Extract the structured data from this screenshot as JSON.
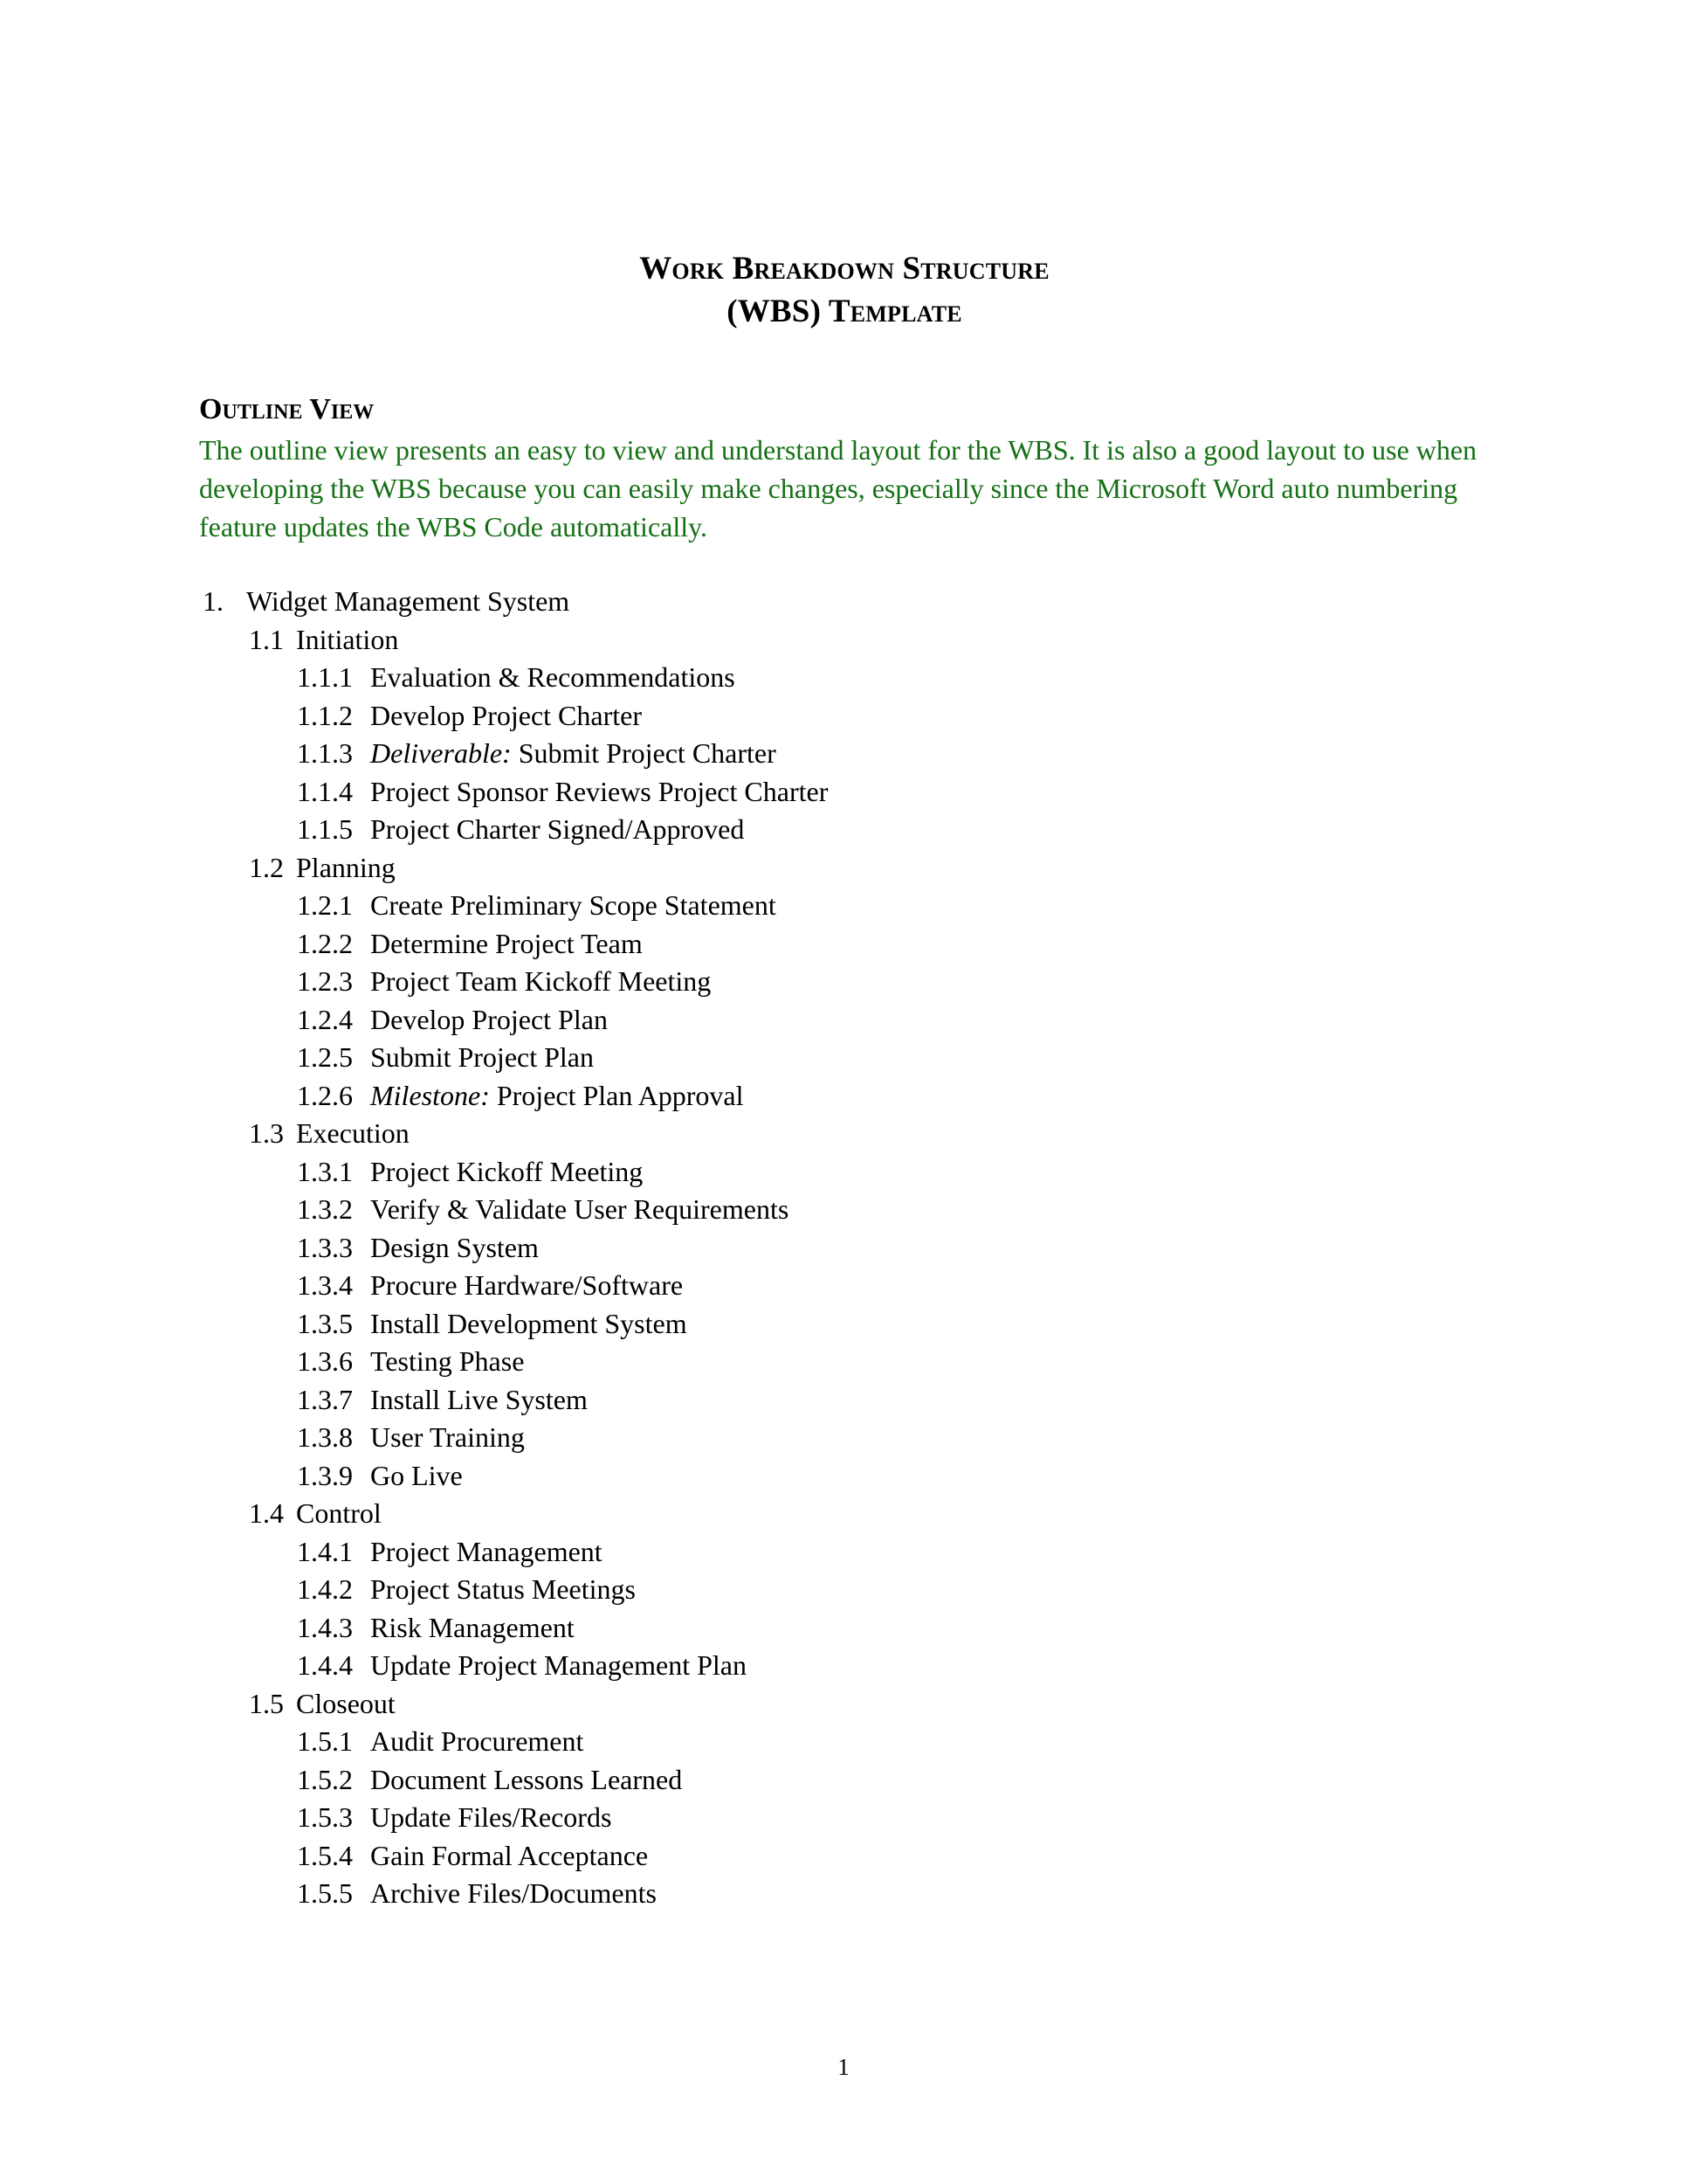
{
  "document": {
    "title_lines": [
      "Work Breakdown Structure",
      "(WBS) Template"
    ],
    "section_heading": "Outline View",
    "intro_paragraph": "The outline view presents an easy to view and understand layout for the WBS.  It is also a good layout to use when developing the WBS because you can easily make changes, especially since the Microsoft Word auto numbering feature updates the WBS Code automatically.",
    "intro_color": "#157015",
    "page_number": "1"
  },
  "outline": {
    "items": [
      {
        "level": 1,
        "code": "1.",
        "text": "Widget Management System"
      },
      {
        "level": 2,
        "code": "1.1",
        "text": "Initiation"
      },
      {
        "level": 3,
        "code": "1.1.1",
        "text": "Evaluation & Recommendations"
      },
      {
        "level": 3,
        "code": "1.1.2",
        "text": "Develop Project Charter"
      },
      {
        "level": 3,
        "code": "1.1.3",
        "emphasis": "Deliverable:",
        "text": " Submit Project Charter"
      },
      {
        "level": 3,
        "code": "1.1.4",
        "text": "Project Sponsor Reviews Project Charter"
      },
      {
        "level": 3,
        "code": "1.1.5",
        "text": "Project Charter Signed/Approved"
      },
      {
        "level": 2,
        "code": "1.2",
        "text": "Planning"
      },
      {
        "level": 3,
        "code": "1.2.1",
        "text": "Create Preliminary Scope Statement"
      },
      {
        "level": 3,
        "code": "1.2.2",
        "text": "Determine Project Team"
      },
      {
        "level": 3,
        "code": "1.2.3",
        "text": "Project Team Kickoff Meeting"
      },
      {
        "level": 3,
        "code": "1.2.4",
        "text": "Develop Project Plan"
      },
      {
        "level": 3,
        "code": "1.2.5",
        "text": "Submit Project Plan"
      },
      {
        "level": 3,
        "code": "1.2.6",
        "emphasis": "Milestone:",
        "text": " Project Plan Approval"
      },
      {
        "level": 2,
        "code": "1.3",
        "text": "Execution"
      },
      {
        "level": 3,
        "code": "1.3.1",
        "text": "Project Kickoff Meeting"
      },
      {
        "level": 3,
        "code": "1.3.2",
        "text": "Verify & Validate User Requirements"
      },
      {
        "level": 3,
        "code": "1.3.3",
        "text": "Design System"
      },
      {
        "level": 3,
        "code": "1.3.4",
        "text": "Procure Hardware/Software"
      },
      {
        "level": 3,
        "code": "1.3.5",
        "text": "Install Development System"
      },
      {
        "level": 3,
        "code": "1.3.6",
        "text": "Testing Phase"
      },
      {
        "level": 3,
        "code": "1.3.7",
        "text": "Install Live System"
      },
      {
        "level": 3,
        "code": "1.3.8",
        "text": "User Training"
      },
      {
        "level": 3,
        "code": "1.3.9",
        "text": "Go Live"
      },
      {
        "level": 2,
        "code": "1.4",
        "text": "Control"
      },
      {
        "level": 3,
        "code": "1.4.1",
        "text": "Project Management"
      },
      {
        "level": 3,
        "code": "1.4.2",
        "text": "Project Status Meetings"
      },
      {
        "level": 3,
        "code": "1.4.3",
        "text": "Risk Management"
      },
      {
        "level": 3,
        "code": "1.4.4",
        "text": "Update Project Management Plan"
      },
      {
        "level": 2,
        "code": "1.5",
        "text": "Closeout"
      },
      {
        "level": 3,
        "code": "1.5.1",
        "text": "Audit Procurement"
      },
      {
        "level": 3,
        "code": "1.5.2",
        "text": "Document Lessons Learned"
      },
      {
        "level": 3,
        "code": "1.5.3",
        "text": "Update Files/Records"
      },
      {
        "level": 3,
        "code": "1.5.4",
        "text": "Gain Formal Acceptance"
      },
      {
        "level": 3,
        "code": "1.5.5",
        "text": "Archive Files/Documents"
      }
    ]
  }
}
